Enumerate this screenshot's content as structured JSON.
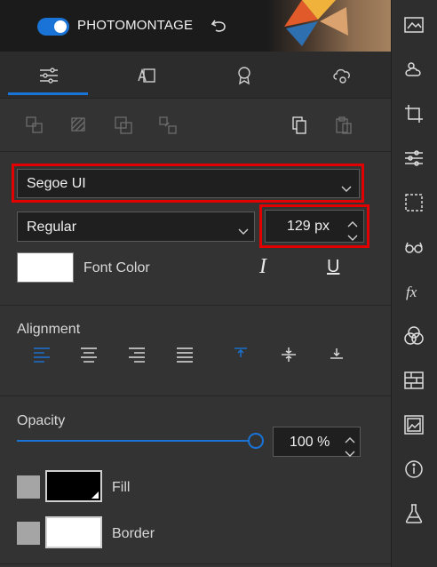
{
  "header": {
    "toggle_on": true,
    "title": "PHOTOMONTAGE"
  },
  "tabs": [
    {
      "icon": "sliders-icon",
      "active": true
    },
    {
      "icon": "text-frame-icon",
      "active": false
    },
    {
      "icon": "badge-icon",
      "active": false
    },
    {
      "icon": "cloud-settings-icon",
      "active": false
    }
  ],
  "font": {
    "family": "Segoe UI",
    "style": "Regular",
    "size": "129 px",
    "color_label": "Font Color",
    "color_value": "#ffffff",
    "italic_glyph": "I",
    "underline_glyph": "U"
  },
  "alignment": {
    "label": "Alignment"
  },
  "opacity": {
    "label": "Opacity",
    "value": "100 %",
    "level": 1.0
  },
  "fill": {
    "label": "Fill",
    "color": "#000000"
  },
  "border": {
    "label": "Border",
    "color": "#ffffff"
  },
  "rail_icons": [
    "image-effect-icon",
    "weather-icon",
    "crop-icon",
    "adjust-icon",
    "selection-icon",
    "glasses-icon",
    "fx-icon",
    "color-blend-icon",
    "texture-icon",
    "frame-icon",
    "info-icon",
    "lab-icon"
  ],
  "colors": {
    "accent": "#1a73d6",
    "highlight": "#e00000"
  }
}
